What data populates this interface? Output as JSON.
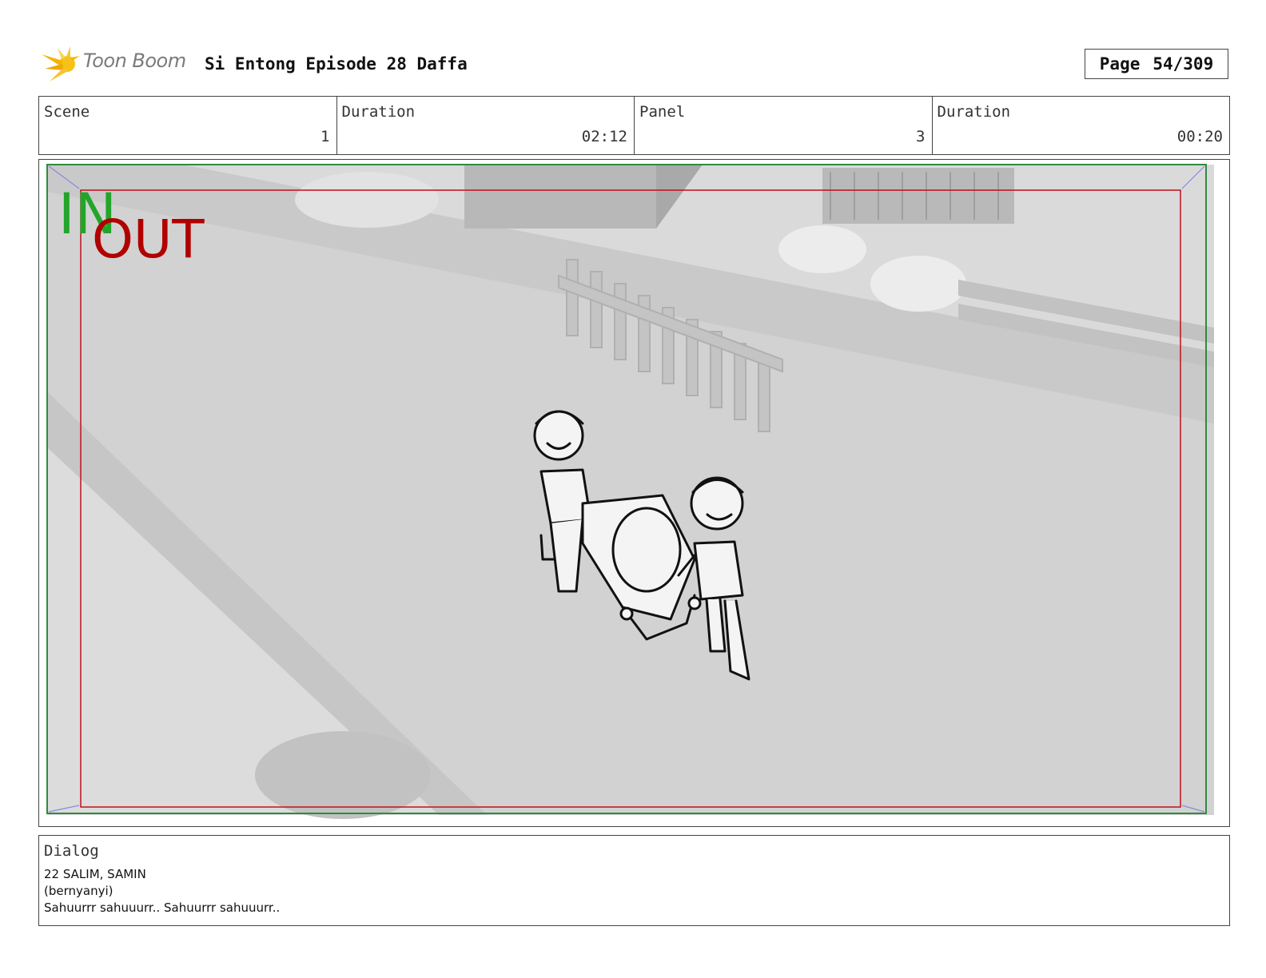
{
  "header": {
    "logo_text": "Toon Boom",
    "title": "Si Entong Episode 28 Daffa",
    "page_label": "Page",
    "page_value": "54/309"
  },
  "info": [
    {
      "label": "Scene",
      "value": "1"
    },
    {
      "label": "Duration",
      "value": "02:12"
    },
    {
      "label": "Panel",
      "value": "3"
    },
    {
      "label": "Duration",
      "value": "00:20"
    }
  ],
  "frame": {
    "in_label": "IN",
    "out_label": "OUT",
    "in_color": "#22a52a",
    "out_color": "#b00000"
  },
  "dialog": {
    "label": "Dialog",
    "lines": [
      "22 SALIM, SAMIN",
      "(bernyanyi)",
      "Sahuurrr sahuuurr.. Sahuurrr sahuuurr.."
    ]
  }
}
